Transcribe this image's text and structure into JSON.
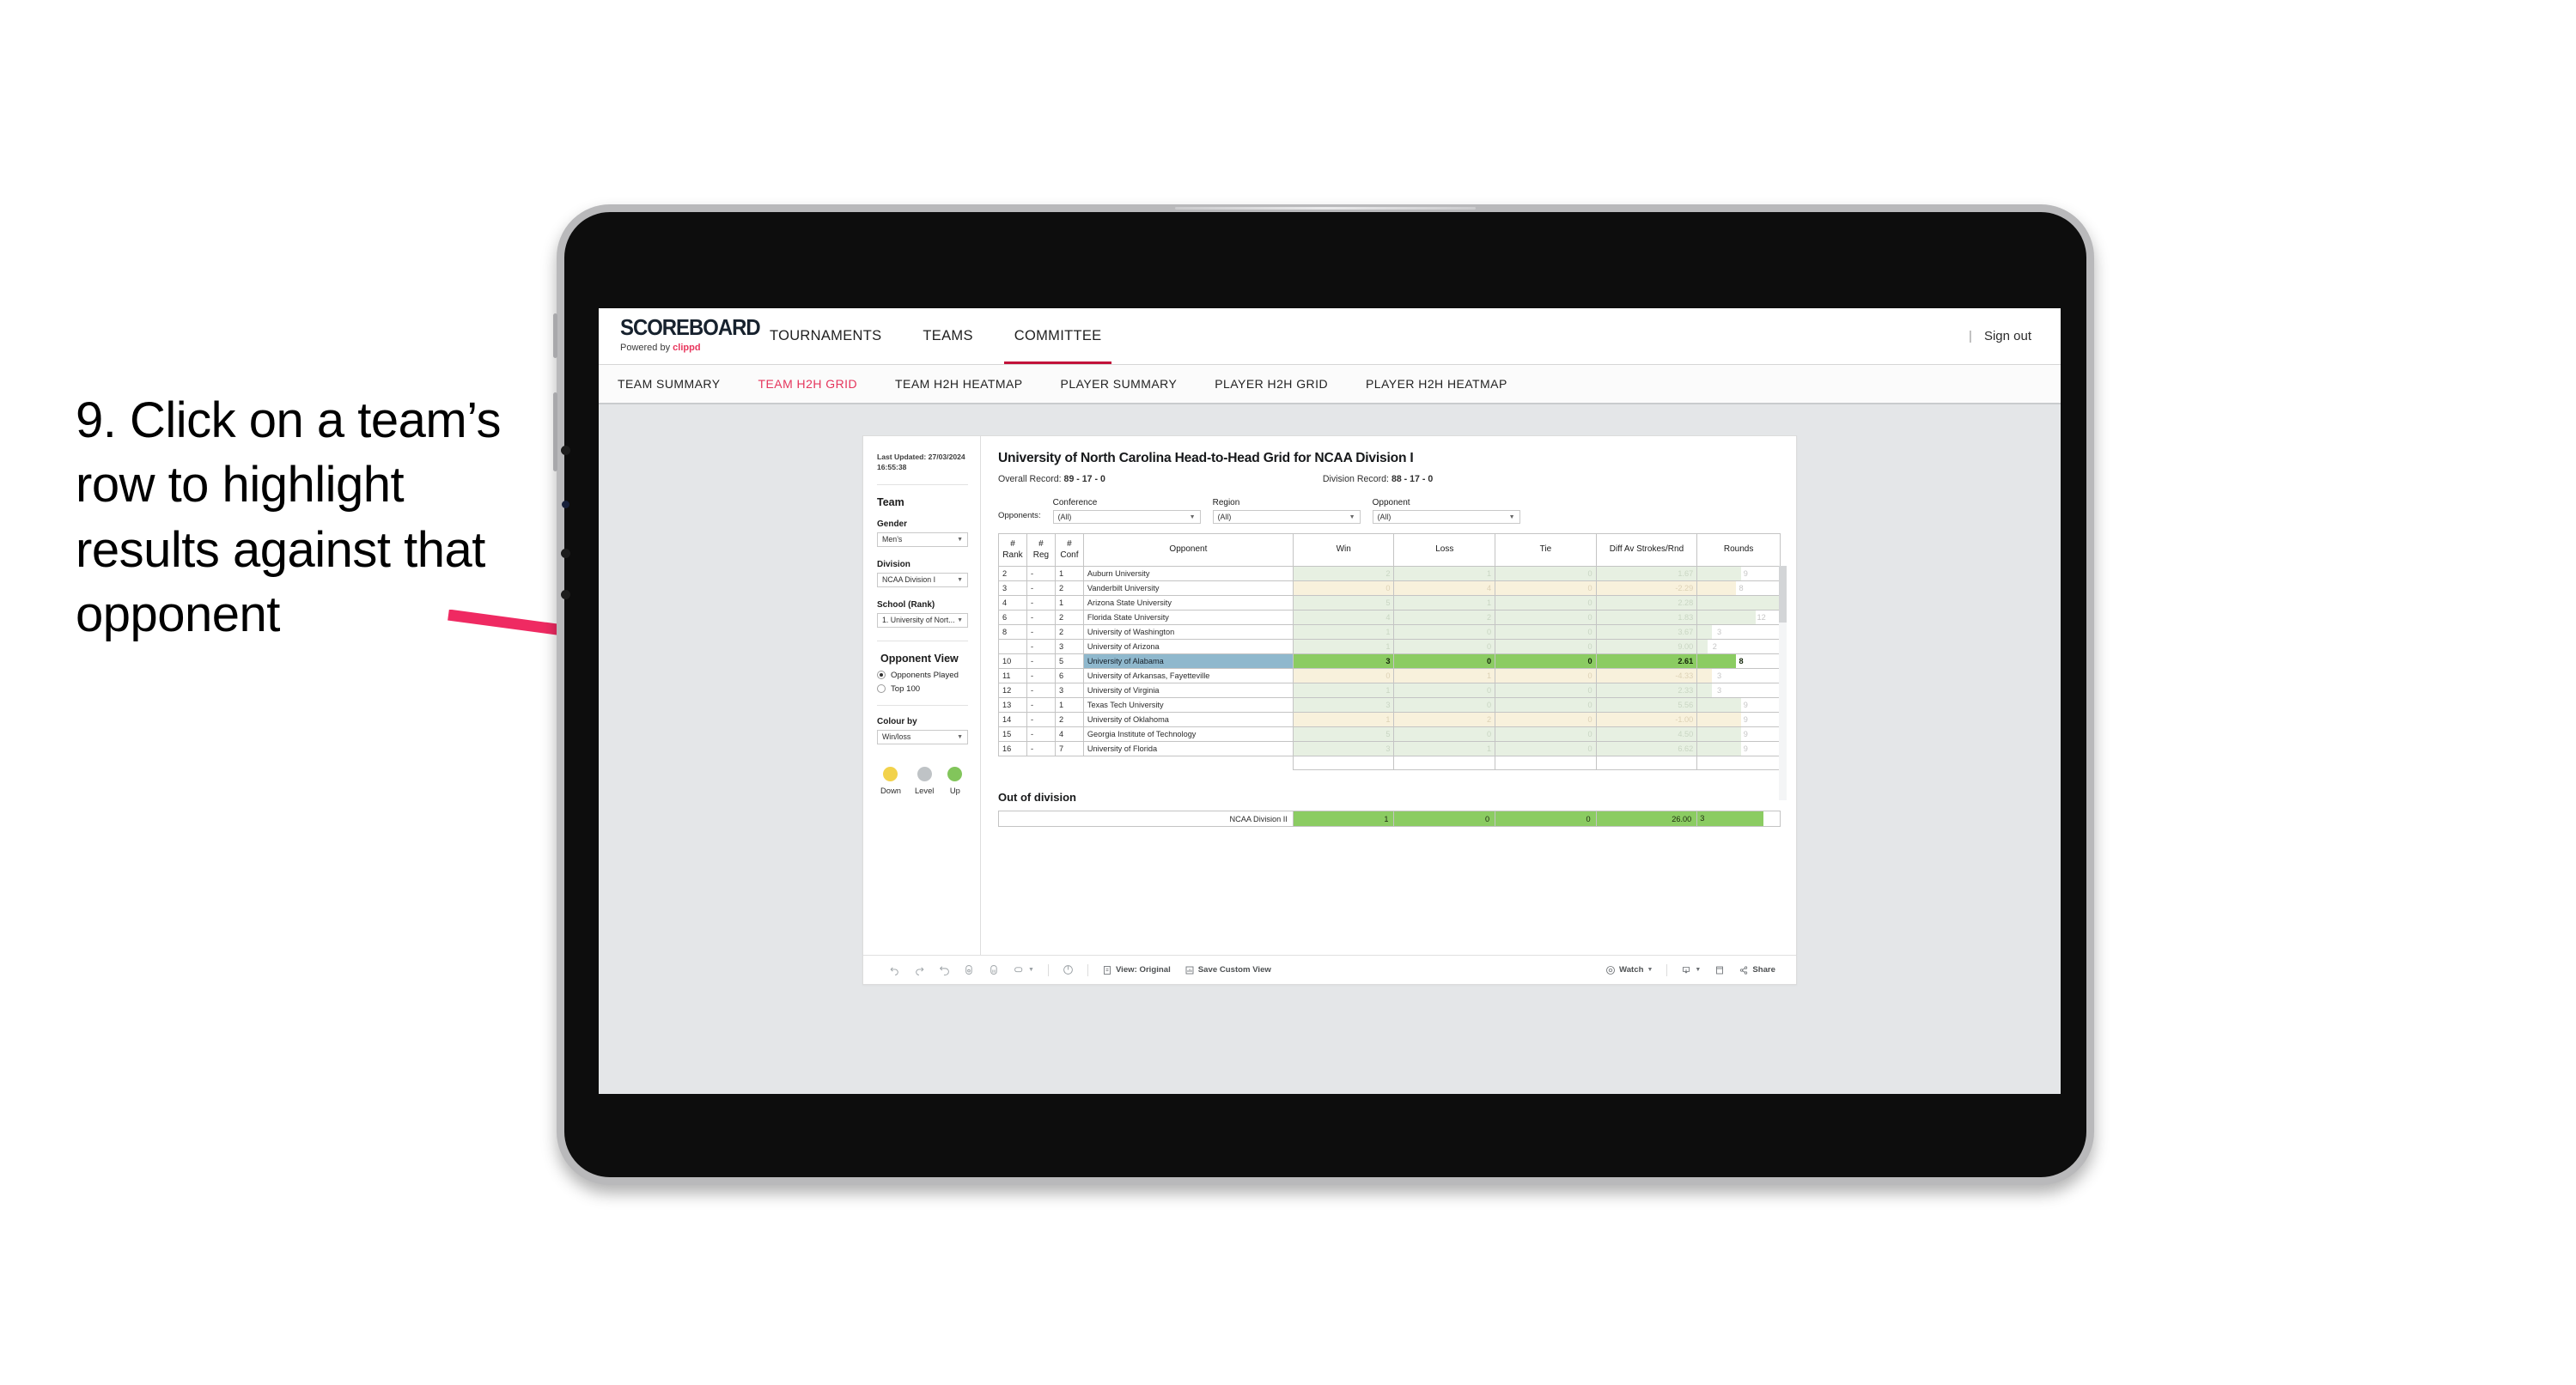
{
  "annotation": {
    "text": "9. Click on a team’s row to highlight results against that opponent",
    "arrow_color": "#ef2a62"
  },
  "app": {
    "brand": {
      "name": "SCOREBOARD",
      "powered_prefix": "Powered by ",
      "powered_brand": "clippd"
    },
    "top_nav": [
      {
        "label": "TOURNAMENTS",
        "active": false
      },
      {
        "label": "TEAMS",
        "active": false
      },
      {
        "label": "COMMITTEE",
        "active": true
      }
    ],
    "signout": {
      "divider": "|",
      "label": "Sign out"
    },
    "sub_nav": [
      {
        "label": "TEAM SUMMARY",
        "active": false
      },
      {
        "label": "TEAM H2H GRID",
        "active": true
      },
      {
        "label": "TEAM H2H HEATMAP",
        "active": false
      },
      {
        "label": "PLAYER SUMMARY",
        "active": false
      },
      {
        "label": "PLAYER H2H GRID",
        "active": false
      },
      {
        "label": "PLAYER H2H HEATMAP",
        "active": false
      }
    ]
  },
  "sidebar": {
    "last_updated_label": "Last Updated: 27/03/2024",
    "last_updated_time": "16:55:38",
    "team_heading": "Team",
    "gender": {
      "label": "Gender",
      "value": "Men’s"
    },
    "division": {
      "label": "Division",
      "value": "NCAA Division I"
    },
    "school": {
      "label": "School (Rank)",
      "value": "1. University of Nort..."
    },
    "opponent_view": {
      "heading": "Opponent View",
      "options": [
        {
          "label": "Opponents Played",
          "selected": true
        },
        {
          "label": "Top 100",
          "selected": false
        }
      ]
    },
    "colour_by": {
      "label": "Colour by",
      "value": "Win/loss"
    },
    "legend": [
      {
        "label": "Down",
        "color": "#f2d24b"
      },
      {
        "label": "Level",
        "color": "#bfc3c6"
      },
      {
        "label": "Up",
        "color": "#82c55b"
      }
    ]
  },
  "view": {
    "title": "University of North Carolina Head-to-Head Grid for NCAA Division I",
    "overall_record_label": "Overall Record:",
    "overall_record_value": "89 - 17 - 0",
    "division_record_label": "Division Record:",
    "division_record_value": "88 - 17 - 0",
    "opponents_lead": "Opponents:",
    "filters": [
      {
        "name": "Conference",
        "value": "(All)"
      },
      {
        "name": "Region",
        "value": "(All)"
      },
      {
        "name": "Opponent",
        "value": "(All)"
      }
    ]
  },
  "chart_data": {
    "type": "table",
    "title": "University of North Carolina Head-to-Head Grid for NCAA Division I",
    "columns": [
      "# Rank",
      "# Reg",
      "# Conf",
      "Opponent",
      "Win",
      "Loss",
      "Tie",
      "Diff Av Strokes/Rnd",
      "Rounds"
    ],
    "rounds_max": 17,
    "rows": [
      {
        "rank": "2",
        "reg": "-",
        "conf": "1",
        "opponent": "Auburn University",
        "win": "2",
        "loss": "1",
        "tie": "0",
        "diff": "1.67",
        "rounds": "9",
        "tone": "pos",
        "highlight": false
      },
      {
        "rank": "3",
        "reg": "-",
        "conf": "2",
        "opponent": "Vanderbilt University",
        "win": "0",
        "loss": "4",
        "tie": "0",
        "diff": "-2.29",
        "rounds": "8",
        "tone": "neg",
        "highlight": false
      },
      {
        "rank": "4",
        "reg": "-",
        "conf": "1",
        "opponent": "Arizona State University",
        "win": "5",
        "loss": "1",
        "tie": "0",
        "diff": "2.28",
        "rounds": "17",
        "tone": "pos",
        "highlight": false
      },
      {
        "rank": "6",
        "reg": "-",
        "conf": "2",
        "opponent": "Florida State University",
        "win": "4",
        "loss": "2",
        "tie": "0",
        "diff": "1.83",
        "rounds": "12",
        "tone": "pos",
        "highlight": false
      },
      {
        "rank": "8",
        "reg": "-",
        "conf": "2",
        "opponent": "University of Washington",
        "win": "1",
        "loss": "0",
        "tie": "0",
        "diff": "3.67",
        "rounds": "3",
        "tone": "pos",
        "highlight": false
      },
      {
        "rank": "",
        "reg": "-",
        "conf": "3",
        "opponent": "University of Arizona",
        "win": "1",
        "loss": "0",
        "tie": "0",
        "diff": "9.00",
        "rounds": "2",
        "tone": "pos",
        "highlight": false
      },
      {
        "rank": "10",
        "reg": "-",
        "conf": "5",
        "opponent": "University of Alabama",
        "win": "3",
        "loss": "0",
        "tie": "0",
        "diff": "2.61",
        "rounds": "8",
        "tone": "pos",
        "highlight": true
      },
      {
        "rank": "11",
        "reg": "-",
        "conf": "6",
        "opponent": "University of Arkansas, Fayetteville",
        "win": "0",
        "loss": "1",
        "tie": "0",
        "diff": "-4.33",
        "rounds": "3",
        "tone": "neg",
        "highlight": false
      },
      {
        "rank": "12",
        "reg": "-",
        "conf": "3",
        "opponent": "University of Virginia",
        "win": "1",
        "loss": "0",
        "tie": "0",
        "diff": "2.33",
        "rounds": "3",
        "tone": "pos",
        "highlight": false
      },
      {
        "rank": "13",
        "reg": "-",
        "conf": "1",
        "opponent": "Texas Tech University",
        "win": "3",
        "loss": "0",
        "tie": "0",
        "diff": "5.56",
        "rounds": "9",
        "tone": "pos",
        "highlight": false
      },
      {
        "rank": "14",
        "reg": "-",
        "conf": "2",
        "opponent": "University of Oklahoma",
        "win": "1",
        "loss": "2",
        "tie": "0",
        "diff": "-1.00",
        "rounds": "9",
        "tone": "neg",
        "highlight": false
      },
      {
        "rank": "15",
        "reg": "-",
        "conf": "4",
        "opponent": "Georgia Institute of Technology",
        "win": "5",
        "loss": "0",
        "tie": "0",
        "diff": "4.50",
        "rounds": "9",
        "tone": "pos",
        "highlight": false
      },
      {
        "rank": "16",
        "reg": "-",
        "conf": "7",
        "opponent": "University of Florida",
        "win": "3",
        "loss": "1",
        "tie": "0",
        "diff": "6.62",
        "rounds": "9",
        "tone": "pos",
        "highlight": false
      }
    ]
  },
  "out_of_division": {
    "title": "Out of division",
    "row": {
      "label": "NCAA Division II",
      "win": "1",
      "loss": "0",
      "tie": "0",
      "diff": "26.00",
      "rounds": "3"
    }
  },
  "toolbar": {
    "view_label": "View: Original",
    "save_label": "Save Custom View",
    "watch_label": "Watch",
    "share_label": "Share",
    "caret": "▾"
  }
}
